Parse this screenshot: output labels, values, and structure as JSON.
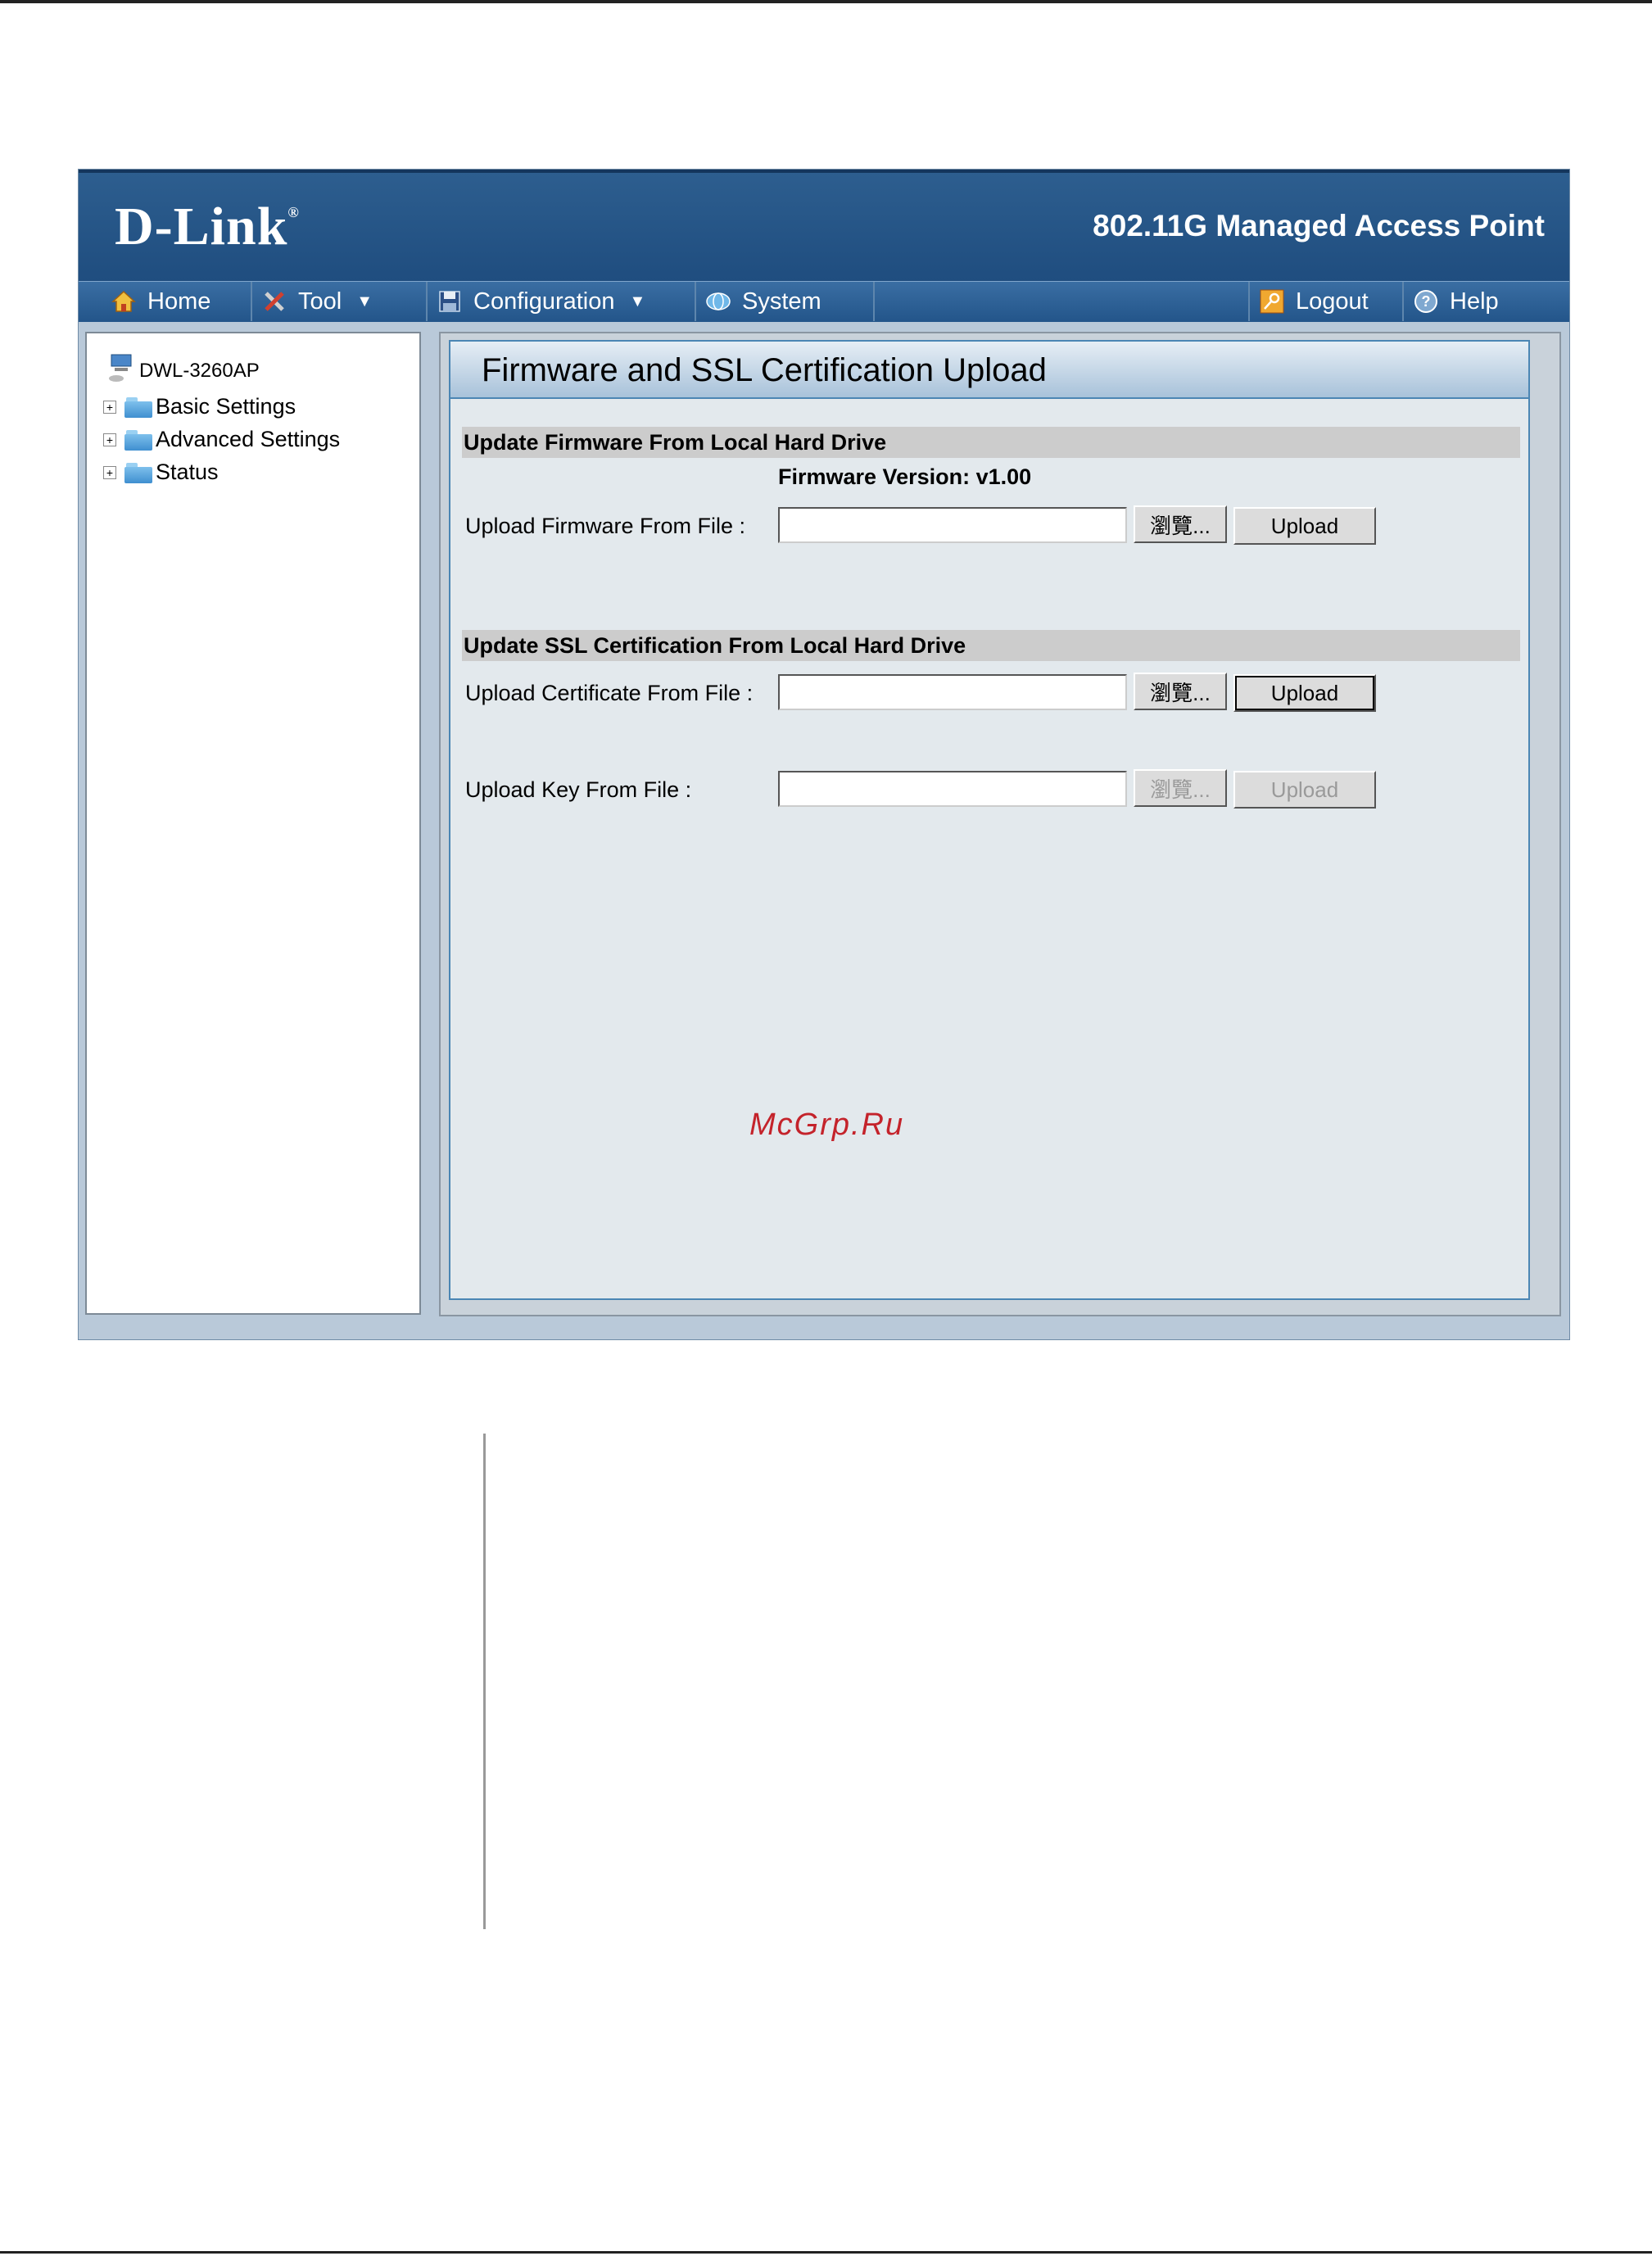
{
  "header": {
    "logo": "D-Link",
    "logo_mark": "®",
    "product": "802.11G Managed Access Point"
  },
  "nav": {
    "home": "Home",
    "tool": "Tool",
    "configuration": "Configuration",
    "system": "System",
    "logout": "Logout",
    "help": "Help"
  },
  "tree": {
    "root": "DWL-3260AP",
    "items": [
      "Basic Settings",
      "Advanced Settings",
      "Status"
    ]
  },
  "page": {
    "title": "Firmware and SSL Certification Upload",
    "firmware_section": "Update Firmware From Local Hard Drive",
    "firmware_version": "Firmware Version: v1.00",
    "firmware_label": "Upload Firmware From File :",
    "ssl_section": "Update SSL Certification From Local Hard Drive",
    "cert_label": "Upload Certificate From File :",
    "key_label": "Upload Key From File :",
    "browse_label": "瀏覽...",
    "upload_label": "Upload",
    "firmware_file_value": "",
    "cert_file_value": "",
    "key_file_value": ""
  },
  "watermark": "McGrp.Ru"
}
